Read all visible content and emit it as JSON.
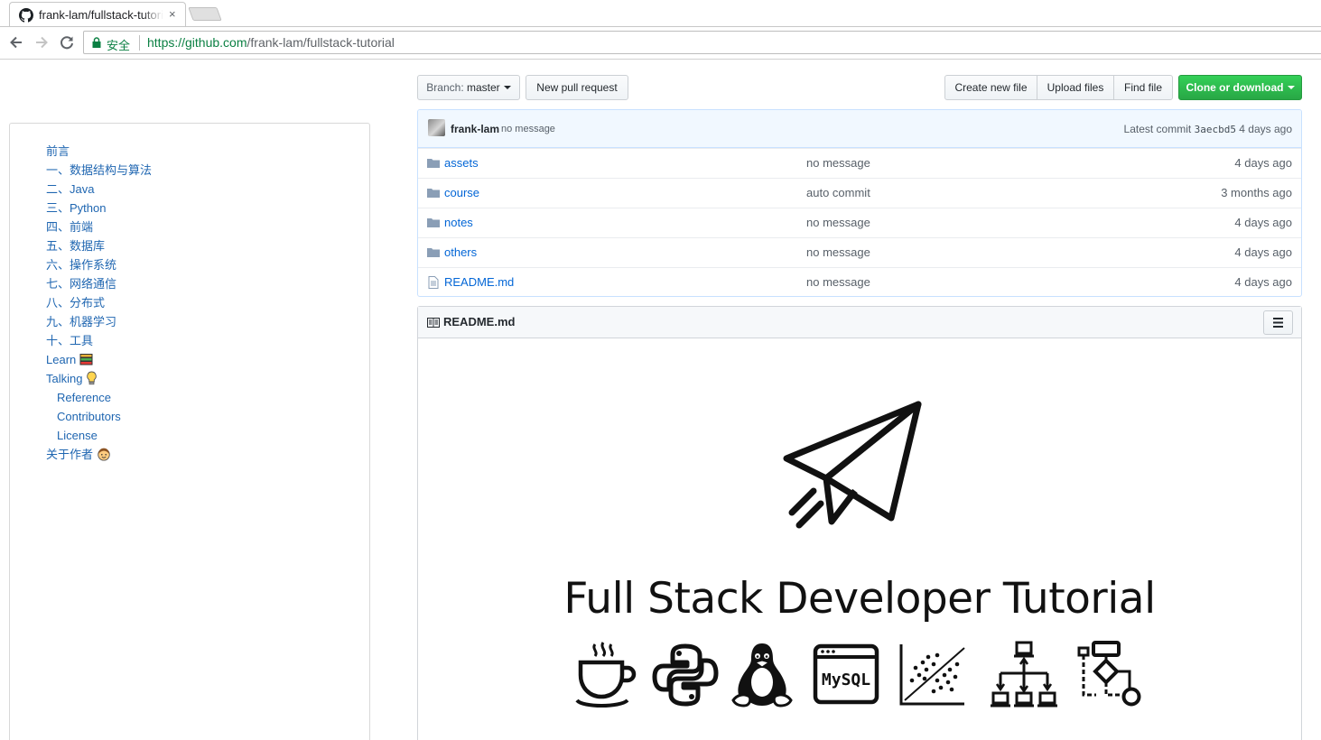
{
  "browser": {
    "tab_title": "frank-lam/fullstack-tutorial",
    "tab_close": "×",
    "secure_label": "安全",
    "url_host": "https://github.com",
    "url_path": "/frank-lam/fullstack-tutorial"
  },
  "toc": {
    "items": [
      {
        "label": "前言",
        "level": 1
      },
      {
        "label": "一、数据结构与算法",
        "level": 1
      },
      {
        "label": "二、Java",
        "level": 1
      },
      {
        "label": "三、Python",
        "level": 1
      },
      {
        "label": "四、前端",
        "level": 1
      },
      {
        "label": "五、数据库",
        "level": 1
      },
      {
        "label": "六、操作系统",
        "level": 1
      },
      {
        "label": "七、网络通信",
        "level": 1
      },
      {
        "label": "八、分布式",
        "level": 1
      },
      {
        "label": "九、机器学习",
        "level": 1
      },
      {
        "label": "十、工具",
        "level": 1
      },
      {
        "label": "Learn",
        "level": 1
      },
      {
        "label": "Talking",
        "level": 1
      },
      {
        "label": "Reference",
        "level": 2
      },
      {
        "label": "Contributors",
        "level": 2
      },
      {
        "label": "License",
        "level": 2
      },
      {
        "label": "关于作者",
        "level": 1
      }
    ]
  },
  "repo": {
    "branch_prefix": "Branch:",
    "branch_name": "master",
    "new_pr": "New pull request",
    "create_file": "Create new file",
    "upload_files": "Upload files",
    "find_file": "Find file",
    "clone": "Clone or download",
    "commit": {
      "author": "frank-lam",
      "message": "no message",
      "latest_label": "Latest commit",
      "sha": "3aecbd5",
      "age": "4 days ago"
    },
    "files": [
      {
        "name": "assets",
        "type": "dir",
        "message": "no message",
        "age": "4 days ago"
      },
      {
        "name": "course",
        "type": "dir",
        "message": "auto commit",
        "age": "3 months ago"
      },
      {
        "name": "notes",
        "type": "dir",
        "message": "no message",
        "age": "4 days ago"
      },
      {
        "name": "others",
        "type": "dir",
        "message": "no message",
        "age": "4 days ago"
      },
      {
        "name": "README.md",
        "type": "file",
        "message": "no message",
        "age": "4 days ago"
      }
    ]
  },
  "readme": {
    "title": "README.md",
    "banner_title": "Full Stack Developer Tutorial",
    "mysql_label": "MySQL",
    "tech_icons": [
      "java-cup-icon",
      "python-icon",
      "linux-tux-icon",
      "mysql-icon",
      "machine-learning-chart-icon",
      "distributed-network-icon",
      "flowchart-icon"
    ]
  },
  "colors": {
    "link": "#0366d6",
    "toc_link": "#1f66b1",
    "clone_green": "#28a745",
    "secure_green": "#0b8043",
    "commit_bar": "#f1f8ff"
  }
}
